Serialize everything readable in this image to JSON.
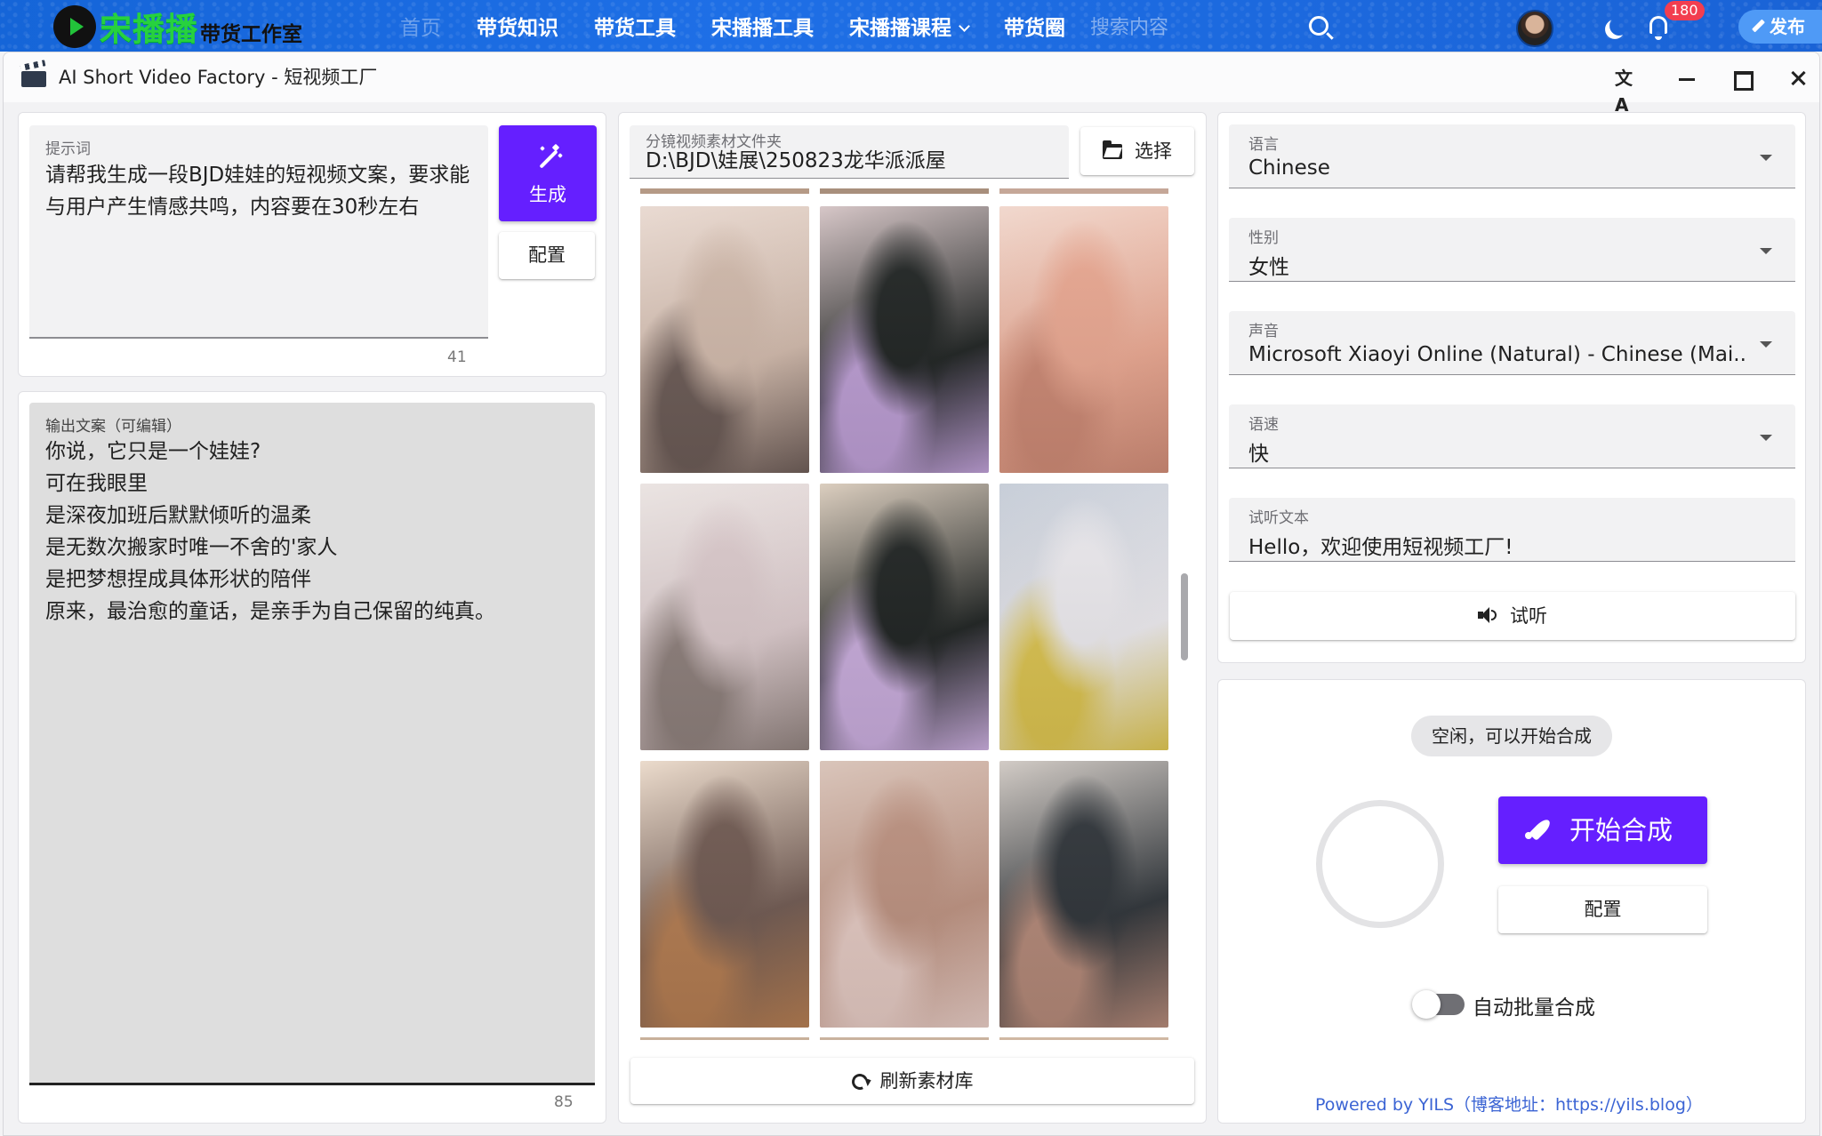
{
  "site": {
    "logo_main": "宋播播",
    "logo_sub": "带货工作室",
    "nav": [
      {
        "label": "首页",
        "active": true
      },
      {
        "label": "带货知识"
      },
      {
        "label": "带货工具"
      },
      {
        "label": "宋播播工具"
      },
      {
        "label": "宋播播课程",
        "dropdown": true
      },
      {
        "label": "带货圈"
      }
    ],
    "search_placeholder": "搜索内容",
    "notification_count": "180",
    "publish_label": "发布"
  },
  "window": {
    "title": "AI Short Video Factory - 短视频工厂",
    "controls": [
      "translate-icon",
      "minimize-icon",
      "maximize-icon",
      "close-icon"
    ],
    "translate_glyph": "文A"
  },
  "prompt": {
    "label": "提示词",
    "value": "请帮我生成一段BJD娃娃的短视频文案，要求能与用户产生情感共鸣，内容要在30秒左右",
    "count": "41",
    "generate_label": "生成",
    "config_label": "配置"
  },
  "output": {
    "label": "输出文案（可编辑）",
    "value": "你说，它只是一个娃娃?\n可在我眼里\n是深夜加班后默默倾听的温柔\n是无数次搬家时唯一不舍的'家人\n是把梦想捏成具体形状的陪伴\n原来，最治愈的童话，是亲手为自己保留的纯真。",
    "count": "85"
  },
  "material": {
    "folder_label": "分镜视频素材文件夹",
    "folder_value": "D:\\BJD\\娃展\\250823龙华派派屋",
    "select_label": "选择",
    "refresh_label": "刷新素材库",
    "thumbs": [
      {
        "colors": [
          "#e8d8cf",
          "#cdb6a8",
          "#6a5a55"
        ]
      },
      {
        "colors": [
          "#d4c3c4",
          "#1f2322",
          "#b99bd0"
        ]
      },
      {
        "colors": [
          "#f0d6cb",
          "#e6a58f",
          "#c98773"
        ]
      },
      {
        "colors": [
          "#e9e2e0",
          "#d7c6c8",
          "#8c7e7a"
        ]
      },
      {
        "colors": [
          "#d9cbbb",
          "#1e2221",
          "#c5a9d8"
        ]
      },
      {
        "colors": [
          "#c4cbd6",
          "#e8e6ea",
          "#d8c04f"
        ]
      },
      {
        "colors": [
          "#ead9c9",
          "#6e5850",
          "#b07a50"
        ]
      },
      {
        "colors": [
          "#d7c1b6",
          "#b98f7e",
          "#e0c6bf"
        ]
      },
      {
        "colors": [
          "#cfc8c2",
          "#2e3338",
          "#b08676"
        ]
      }
    ]
  },
  "tts": {
    "language": {
      "label": "语言",
      "value": "Chinese"
    },
    "gender": {
      "label": "性别",
      "value": "女性"
    },
    "voice": {
      "label": "声音",
      "value": "Microsoft Xiaoyi Online (Natural) - Chinese (Mai..."
    },
    "speed": {
      "label": "语速",
      "value": "快"
    },
    "preview_text": {
      "label": "试听文本",
      "value": "Hello，欢迎使用短视频工厂!"
    },
    "listen_label": "试听"
  },
  "synth": {
    "status": "空闲，可以开始合成",
    "start_label": "开始合成",
    "config_label": "配置",
    "auto_batch_label": "自动批量合成",
    "auto_batch_on": false
  },
  "footer": {
    "powered": "Powered by YILS（博客地址：https://yils.blog）"
  }
}
